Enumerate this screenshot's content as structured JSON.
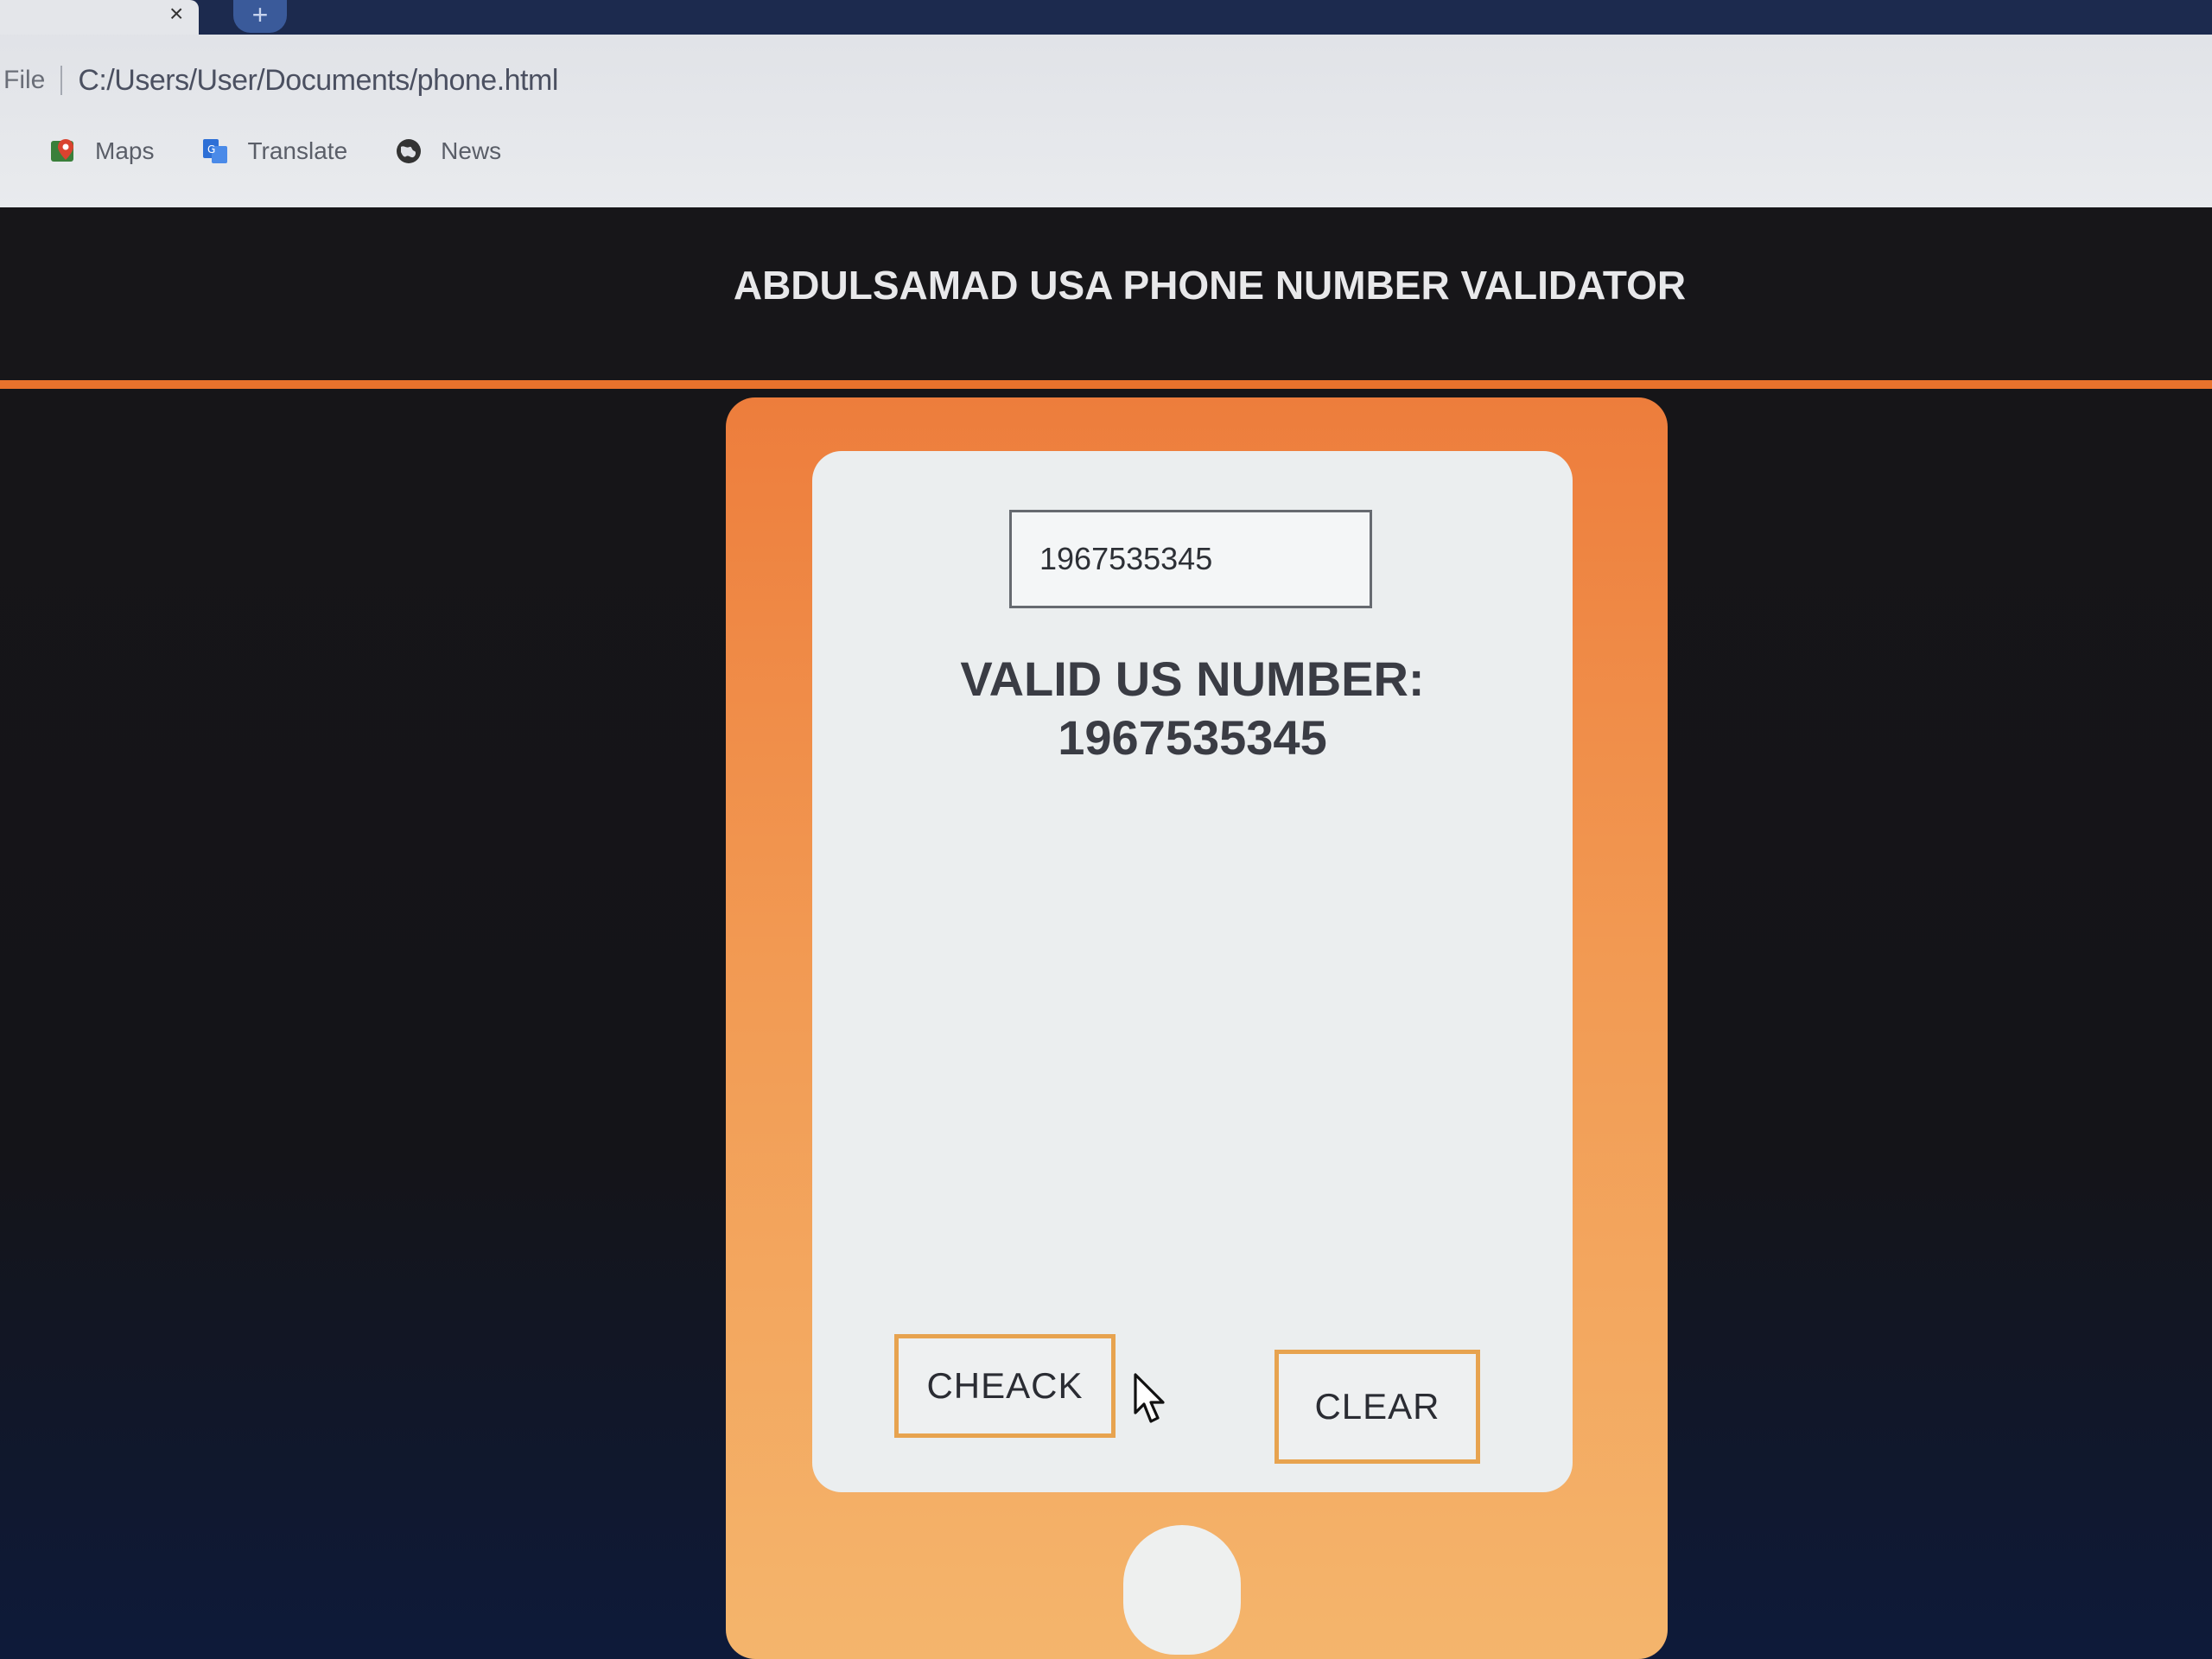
{
  "browser": {
    "tab_close_glyph": "×",
    "new_tab_glyph": "+",
    "address": {
      "scheme": "File",
      "url": "C:/Users/User/Documents/phone.html"
    },
    "bookmarks": [
      {
        "icon": "maps-icon",
        "label": "Maps",
        "color": "#d9432f"
      },
      {
        "icon": "translate-icon",
        "label": "Translate",
        "color": "#2d6fd6"
      },
      {
        "icon": "globe-icon",
        "label": "News",
        "color": "#333333"
      }
    ]
  },
  "header": {
    "title": "ABDULSAMAD USA PHONE NUMBER VALIDATOR",
    "accent_color": "#e9722c"
  },
  "validator": {
    "input_value": "1967535345",
    "result_line1": "VALID US NUMBER:",
    "result_line2": "1967535345",
    "check_label": "CHEACK",
    "clear_label": "CLEAR"
  }
}
